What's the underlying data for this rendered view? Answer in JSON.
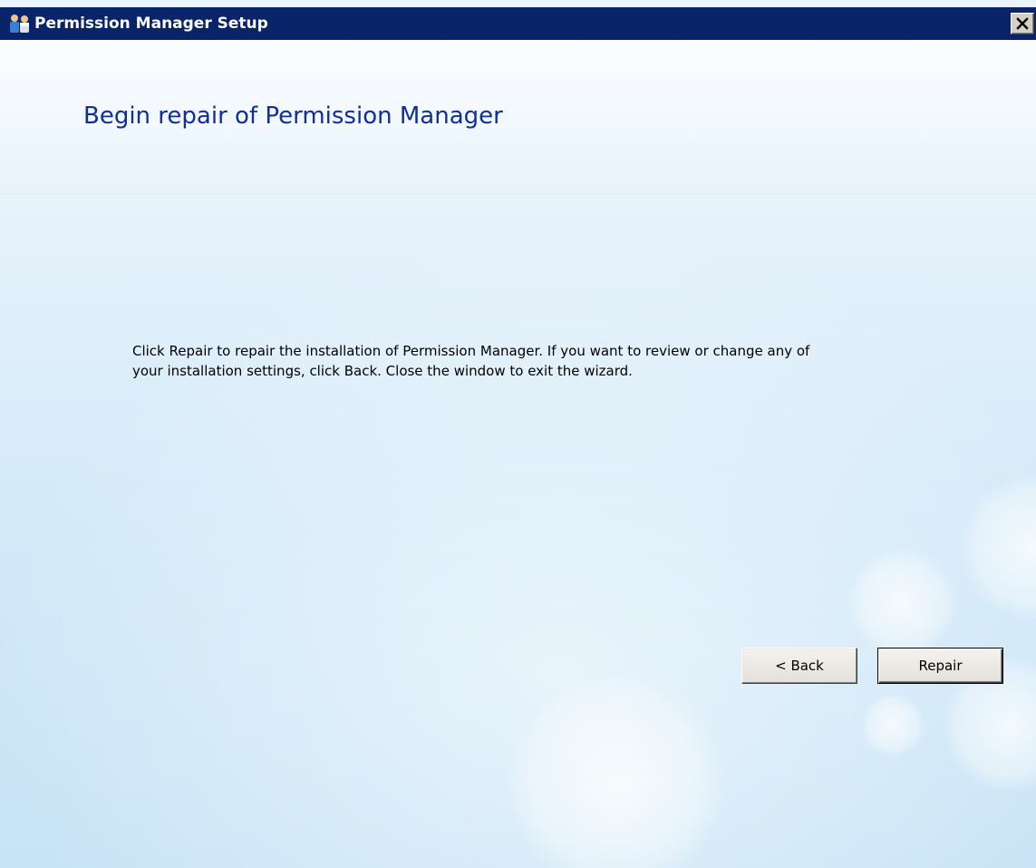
{
  "window": {
    "title": "Permission Manager Setup",
    "titlebar_color": "#0a246a",
    "title_icon": "users-icon",
    "close_icon": "close-icon"
  },
  "header": {
    "title": "Begin repair of Permission Manager",
    "title_color": "#0f2f9a"
  },
  "body": {
    "line1": "Click Repair to repair the installation of Permission Manager.  If you want to review or change any of",
    "line2": "your installation settings, click Back.  Close the window to exit the wizard."
  },
  "buttons": {
    "back_label": "< Back",
    "repair_label": "Repair"
  }
}
